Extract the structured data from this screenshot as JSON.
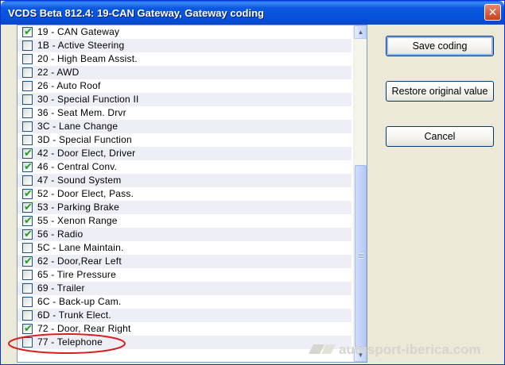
{
  "window": {
    "title": "VCDS Beta 812.4: 19-CAN Gateway,  Gateway coding",
    "close_glyph": "✕"
  },
  "list": {
    "items": [
      {
        "label": "19 - CAN Gateway",
        "checked": true
      },
      {
        "label": "1B - Active Steering",
        "checked": false
      },
      {
        "label": "20 - High Beam Assist.",
        "checked": false
      },
      {
        "label": "22 - AWD",
        "checked": false
      },
      {
        "label": "26 - Auto Roof",
        "checked": false
      },
      {
        "label": "30 - Special Function II",
        "checked": false
      },
      {
        "label": "36 - Seat Mem. Drvr",
        "checked": false
      },
      {
        "label": "3C - Lane Change",
        "checked": false
      },
      {
        "label": "3D - Special Function",
        "checked": false
      },
      {
        "label": "42 - Door Elect, Driver",
        "checked": true
      },
      {
        "label": "46 - Central Conv.",
        "checked": true
      },
      {
        "label": "47 - Sound System",
        "checked": false
      },
      {
        "label": "52 - Door Elect, Pass.",
        "checked": true
      },
      {
        "label": "53 - Parking Brake",
        "checked": true
      },
      {
        "label": "55 - Xenon Range",
        "checked": true
      },
      {
        "label": "56 - Radio",
        "checked": true
      },
      {
        "label": "5C - Lane Maintain.",
        "checked": false
      },
      {
        "label": "62 - Door,Rear Left",
        "checked": true
      },
      {
        "label": "65 - Tire Pressure",
        "checked": false
      },
      {
        "label": "69 - Trailer",
        "checked": false
      },
      {
        "label": "6C - Back-up Cam.",
        "checked": false
      },
      {
        "label": "6D - Trunk Elect.",
        "checked": false
      },
      {
        "label": "72 - Door, Rear Right",
        "checked": true
      },
      {
        "label": "77 - Telephone",
        "checked": false
      }
    ],
    "check_glyph": "✔"
  },
  "scrollbar": {
    "up_glyph": "▲",
    "down_glyph": "▼"
  },
  "buttons": {
    "save": "Save coding",
    "restore": "Restore original value",
    "cancel": "Cancel"
  },
  "annotation": {
    "highlight_color": "#D81E1E",
    "highlighted_item": "77 - Telephone"
  },
  "watermark": {
    "text": "autosport-iberica.com"
  }
}
